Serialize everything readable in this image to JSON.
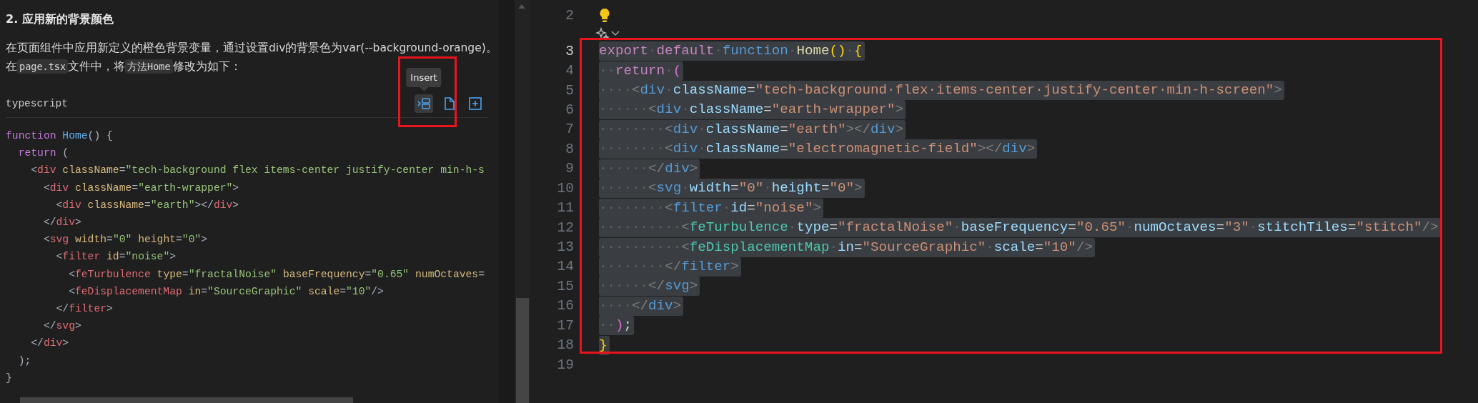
{
  "doc_panel": {
    "heading": "2. 应用新的背景颜色",
    "paragraph_lines": [
      [
        {
          "text": "在页面组件中应用新定义的橙色背景变量，通过设置div的背景色为var(--background-orange)。",
          "code": false
        }
      ],
      [
        {
          "text": "在",
          "code": false
        },
        {
          "text": "page.tsx",
          "code": true
        },
        {
          "text": "文件中，将",
          "code": false
        },
        {
          "text": "方法Home",
          "code": true
        },
        {
          "text": "修改为如下：",
          "code": false
        }
      ]
    ],
    "code_block": {
      "language": "typescript",
      "tooltip": "Insert",
      "actions": [
        {
          "kind": "insert",
          "hovered": true
        },
        {
          "kind": "copy",
          "hovered": false
        },
        {
          "kind": "add",
          "hovered": false
        }
      ],
      "lines": [
        [
          {
            "kind": "kw",
            "text": "function"
          },
          {
            "kind": "fn",
            "text": " Home"
          },
          {
            "kind": "pn",
            "text": "() {"
          }
        ],
        [
          {
            "kind": "kw",
            "text": "  return"
          },
          {
            "kind": "pn",
            "text": " ("
          }
        ],
        [
          {
            "kind": "pn",
            "text": "    <"
          },
          {
            "kind": "tag",
            "text": "div"
          },
          {
            "kind": "attr",
            "text": " className"
          },
          {
            "kind": "pn",
            "text": "="
          },
          {
            "kind": "str",
            "text": "\"tech-background flex items-center justify-center min-h-s"
          }
        ],
        [
          {
            "kind": "pn",
            "text": "      <"
          },
          {
            "kind": "tag",
            "text": "div"
          },
          {
            "kind": "attr",
            "text": " className"
          },
          {
            "kind": "pn",
            "text": "="
          },
          {
            "kind": "str",
            "text": "\"earth-wrapper\""
          },
          {
            "kind": "pn",
            "text": ">"
          }
        ],
        [
          {
            "kind": "pn",
            "text": "        <"
          },
          {
            "kind": "tag",
            "text": "div"
          },
          {
            "kind": "attr",
            "text": " className"
          },
          {
            "kind": "pn",
            "text": "="
          },
          {
            "kind": "str",
            "text": "\"earth\""
          },
          {
            "kind": "pn",
            "text": "></"
          },
          {
            "kind": "tag",
            "text": "div"
          },
          {
            "kind": "pn",
            "text": ">"
          }
        ],
        [
          {
            "kind": "pn",
            "text": "      </"
          },
          {
            "kind": "tag",
            "text": "div"
          },
          {
            "kind": "pn",
            "text": ">"
          }
        ],
        [
          {
            "kind": "pn",
            "text": "      <"
          },
          {
            "kind": "tag",
            "text": "svg"
          },
          {
            "kind": "attr",
            "text": " width"
          },
          {
            "kind": "pn",
            "text": "="
          },
          {
            "kind": "str",
            "text": "\"0\""
          },
          {
            "kind": "attr",
            "text": " height"
          },
          {
            "kind": "pn",
            "text": "="
          },
          {
            "kind": "str",
            "text": "\"0\""
          },
          {
            "kind": "pn",
            "text": ">"
          }
        ],
        [
          {
            "kind": "pn",
            "text": "        <"
          },
          {
            "kind": "tag",
            "text": "filter"
          },
          {
            "kind": "attr",
            "text": " id"
          },
          {
            "kind": "pn",
            "text": "="
          },
          {
            "kind": "str",
            "text": "\"noise\""
          },
          {
            "kind": "pn",
            "text": ">"
          }
        ],
        [
          {
            "kind": "pn",
            "text": "          <"
          },
          {
            "kind": "tag",
            "text": "feTurbulence"
          },
          {
            "kind": "attr",
            "text": " type"
          },
          {
            "kind": "pn",
            "text": "="
          },
          {
            "kind": "str",
            "text": "\"fractalNoise\""
          },
          {
            "kind": "attr",
            "text": " baseFrequency"
          },
          {
            "kind": "pn",
            "text": "="
          },
          {
            "kind": "str",
            "text": "\"0.65\""
          },
          {
            "kind": "attr",
            "text": " numOctaves"
          },
          {
            "kind": "pn",
            "text": "="
          }
        ],
        [
          {
            "kind": "pn",
            "text": "          <"
          },
          {
            "kind": "tag",
            "text": "feDisplacementMap"
          },
          {
            "kind": "attr",
            "text": " in"
          },
          {
            "kind": "pn",
            "text": "="
          },
          {
            "kind": "str",
            "text": "\"SourceGraphic\""
          },
          {
            "kind": "attr",
            "text": " scale"
          },
          {
            "kind": "pn",
            "text": "="
          },
          {
            "kind": "str",
            "text": "\"10\""
          },
          {
            "kind": "pn",
            "text": "/>"
          }
        ],
        [
          {
            "kind": "pn",
            "text": "        </"
          },
          {
            "kind": "tag",
            "text": "filter"
          },
          {
            "kind": "pn",
            "text": ">"
          }
        ],
        [
          {
            "kind": "pn",
            "text": "      </"
          },
          {
            "kind": "tag",
            "text": "svg"
          },
          {
            "kind": "pn",
            "text": ">"
          }
        ],
        [
          {
            "kind": "pn",
            "text": "    </"
          },
          {
            "kind": "tag",
            "text": "div"
          },
          {
            "kind": "pn",
            "text": ">"
          }
        ],
        [
          {
            "kind": "pn",
            "text": "  );"
          }
        ],
        [
          {
            "kind": "pn",
            "text": "}"
          }
        ]
      ]
    }
  },
  "editor": {
    "lines": [
      {
        "number": "2",
        "active": false
      },
      {
        "number": "3",
        "active": true,
        "tokens": [
          {
            "kind": "kw",
            "text": "export"
          },
          {
            "kind": "ws",
            "text": "·"
          },
          {
            "kind": "kw",
            "text": "default"
          },
          {
            "kind": "ws",
            "text": "·"
          },
          {
            "kind": "st",
            "text": "function"
          },
          {
            "kind": "ws",
            "text": "·"
          },
          {
            "kind": "fn",
            "text": "Home"
          },
          {
            "kind": "br",
            "text": "()"
          },
          {
            "kind": "ws",
            "text": "·"
          },
          {
            "kind": "br",
            "text": "{"
          }
        ]
      },
      {
        "number": "4",
        "active": false,
        "tokens": [
          {
            "kind": "ws",
            "text": "··"
          },
          {
            "kind": "kw",
            "text": "return"
          },
          {
            "kind": "ws",
            "text": "·"
          },
          {
            "kind": "br2",
            "text": "("
          }
        ]
      },
      {
        "number": "5",
        "active": false,
        "tokens": [
          {
            "kind": "ws",
            "text": "····"
          },
          {
            "kind": "pn",
            "text": "<"
          },
          {
            "kind": "tag",
            "text": "div"
          },
          {
            "kind": "ws",
            "text": "·"
          },
          {
            "kind": "attr",
            "text": "className"
          },
          {
            "kind": "op",
            "text": "="
          },
          {
            "kind": "str",
            "text": "\"tech-background·flex·items-center·justify-center·min-h-screen\""
          },
          {
            "kind": "pn",
            "text": ">"
          }
        ]
      },
      {
        "number": "6",
        "active": false,
        "tokens": [
          {
            "kind": "ws",
            "text": "······"
          },
          {
            "kind": "pn",
            "text": "<"
          },
          {
            "kind": "tag",
            "text": "div"
          },
          {
            "kind": "ws",
            "text": "·"
          },
          {
            "kind": "attr",
            "text": "className"
          },
          {
            "kind": "op",
            "text": "="
          },
          {
            "kind": "str",
            "text": "\"earth-wrapper\""
          },
          {
            "kind": "pn",
            "text": ">"
          }
        ]
      },
      {
        "number": "7",
        "active": false,
        "tokens": [
          {
            "kind": "ws",
            "text": "········"
          },
          {
            "kind": "pn",
            "text": "<"
          },
          {
            "kind": "tag",
            "text": "div"
          },
          {
            "kind": "ws",
            "text": "·"
          },
          {
            "kind": "attr",
            "text": "className"
          },
          {
            "kind": "op",
            "text": "="
          },
          {
            "kind": "str",
            "text": "\"earth\""
          },
          {
            "kind": "pn",
            "text": "></"
          },
          {
            "kind": "tag",
            "text": "div"
          },
          {
            "kind": "pn",
            "text": ">"
          }
        ]
      },
      {
        "number": "8",
        "active": false,
        "tokens": [
          {
            "kind": "ws",
            "text": "········"
          },
          {
            "kind": "pn",
            "text": "<"
          },
          {
            "kind": "tag",
            "text": "div"
          },
          {
            "kind": "ws",
            "text": "·"
          },
          {
            "kind": "attr",
            "text": "className"
          },
          {
            "kind": "op",
            "text": "="
          },
          {
            "kind": "str",
            "text": "\"electromagnetic-field\""
          },
          {
            "kind": "pn",
            "text": "></"
          },
          {
            "kind": "tag",
            "text": "div"
          },
          {
            "kind": "pn",
            "text": ">"
          }
        ]
      },
      {
        "number": "9",
        "active": false,
        "tokens": [
          {
            "kind": "ws",
            "text": "······"
          },
          {
            "kind": "pn",
            "text": "</"
          },
          {
            "kind": "tag",
            "text": "div"
          },
          {
            "kind": "pn",
            "text": ">"
          }
        ]
      },
      {
        "number": "10",
        "active": false,
        "tokens": [
          {
            "kind": "ws",
            "text": "······"
          },
          {
            "kind": "pn",
            "text": "<"
          },
          {
            "kind": "tag",
            "text": "svg"
          },
          {
            "kind": "ws",
            "text": "·"
          },
          {
            "kind": "attr",
            "text": "width"
          },
          {
            "kind": "op",
            "text": "="
          },
          {
            "kind": "str",
            "text": "\"0\""
          },
          {
            "kind": "ws",
            "text": "·"
          },
          {
            "kind": "attr",
            "text": "height"
          },
          {
            "kind": "op",
            "text": "="
          },
          {
            "kind": "str",
            "text": "\"0\""
          },
          {
            "kind": "pn",
            "text": ">"
          }
        ]
      },
      {
        "number": "11",
        "active": false,
        "tokens": [
          {
            "kind": "ws",
            "text": "········"
          },
          {
            "kind": "pn",
            "text": "<"
          },
          {
            "kind": "tag",
            "text": "filter"
          },
          {
            "kind": "ws",
            "text": "·"
          },
          {
            "kind": "attr",
            "text": "id"
          },
          {
            "kind": "op",
            "text": "="
          },
          {
            "kind": "str",
            "text": "\"noise\""
          },
          {
            "kind": "pn",
            "text": ">"
          }
        ]
      },
      {
        "number": "12",
        "active": false,
        "tokens": [
          {
            "kind": "ws",
            "text": "··········"
          },
          {
            "kind": "pn",
            "text": "<"
          },
          {
            "kind": "comp",
            "text": "feTurbulence"
          },
          {
            "kind": "ws",
            "text": "·"
          },
          {
            "kind": "attr",
            "text": "type"
          },
          {
            "kind": "op",
            "text": "="
          },
          {
            "kind": "str",
            "text": "\"fractalNoise\""
          },
          {
            "kind": "ws",
            "text": "·"
          },
          {
            "kind": "attr",
            "text": "baseFrequency"
          },
          {
            "kind": "op",
            "text": "="
          },
          {
            "kind": "str",
            "text": "\"0.65\""
          },
          {
            "kind": "ws",
            "text": "·"
          },
          {
            "kind": "attr",
            "text": "numOctaves"
          },
          {
            "kind": "op",
            "text": "="
          },
          {
            "kind": "str",
            "text": "\"3\""
          },
          {
            "kind": "ws",
            "text": "·"
          },
          {
            "kind": "attr",
            "text": "stitchTiles"
          },
          {
            "kind": "op",
            "text": "="
          },
          {
            "kind": "str",
            "text": "\"stitch\""
          },
          {
            "kind": "pn",
            "text": "/>"
          }
        ]
      },
      {
        "number": "13",
        "active": false,
        "tokens": [
          {
            "kind": "ws",
            "text": "··········"
          },
          {
            "kind": "pn",
            "text": "<"
          },
          {
            "kind": "comp",
            "text": "feDisplacementMap"
          },
          {
            "kind": "ws",
            "text": "·"
          },
          {
            "kind": "attr",
            "text": "in"
          },
          {
            "kind": "op",
            "text": "="
          },
          {
            "kind": "str",
            "text": "\"SourceGraphic\""
          },
          {
            "kind": "ws",
            "text": "·"
          },
          {
            "kind": "attr",
            "text": "scale"
          },
          {
            "kind": "op",
            "text": "="
          },
          {
            "kind": "str",
            "text": "\"10\""
          },
          {
            "kind": "pn",
            "text": "/>"
          }
        ]
      },
      {
        "number": "14",
        "active": false,
        "tokens": [
          {
            "kind": "ws",
            "text": "········"
          },
          {
            "kind": "pn",
            "text": "</"
          },
          {
            "kind": "tag",
            "text": "filter"
          },
          {
            "kind": "pn",
            "text": ">"
          }
        ]
      },
      {
        "number": "15",
        "active": false,
        "tokens": [
          {
            "kind": "ws",
            "text": "······"
          },
          {
            "kind": "pn",
            "text": "</"
          },
          {
            "kind": "tag",
            "text": "svg"
          },
          {
            "kind": "pn",
            "text": ">"
          }
        ]
      },
      {
        "number": "16",
        "active": false,
        "tokens": [
          {
            "kind": "ws",
            "text": "····"
          },
          {
            "kind": "pn",
            "text": "</"
          },
          {
            "kind": "tag",
            "text": "div"
          },
          {
            "kind": "pn",
            "text": ">"
          }
        ]
      },
      {
        "number": "17",
        "active": false,
        "tokens": [
          {
            "kind": "ws",
            "text": "··"
          },
          {
            "kind": "br2",
            "text": ")"
          },
          {
            "kind": "op",
            "text": ";"
          }
        ]
      },
      {
        "number": "18",
        "active": false,
        "tokens": [
          {
            "kind": "br",
            "text": "}"
          }
        ]
      },
      {
        "number": "19",
        "active": false
      }
    ]
  }
}
